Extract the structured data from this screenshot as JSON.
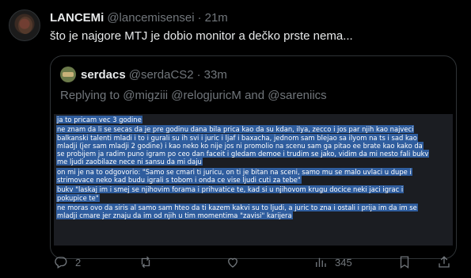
{
  "author": {
    "name": "LANCEMi",
    "handle": "@lancemisensei",
    "dot": "·",
    "time": "21m"
  },
  "tweet_text": "što je najgore MTJ je dobio monitor a dečko prste nema...",
  "quoted": {
    "name": "serdacs",
    "handle": "@serdaCS2",
    "dot": "·",
    "time": "33m",
    "replying_prefix": "Replying to",
    "mention1": "@migziii",
    "mention2": "@relogjuricM",
    "and_word": "and",
    "mention3": "@sareniics",
    "lines": [
      "ja to pricam vec 3 godine",
      "ne znam da li se secas da je pre godinu dana bila prica kao da su kdan, ilya, zecco i jos par njih kao najveci",
      "balkanski talenti mladi i to i gurali su ih svi i juric i ljaf i baxacha, jednom sam blejao sa ilyom na ts i sad kao",
      "mladji (jer sam mladji 2 godine) i kao neko ko nije jos ni promolio na scenu sam ga pitao ee brate kao kako da",
      "se probijem ja radim puno igram po ceo dan faceit i gledam demoe i trudim se jako, vidim da mi nesto fali bukv",
      "me ljudi zaobilaze nece ni sansu da mi daju",
      "on mi je na to odgovorio: \"Samo se cmari ti juricu, on ti je bitan na sceni, samo mu se malo uvlaci u dupe i",
      "strimovace neko kad budu igrali s tobom i onda ce vise ljudi cuti za tebe\"",
      "bukv \"laskaj im i smej se njihovim forama i prihvatice te, kad si u njihovom krugu docice neki jaci igrac i",
      "pokupice te\"",
      "ne moras ovo da siris al samo sam hteo da ti kazem kakvi su to ljudi, a juric to zna i ostali i prija im da im se",
      "mladji cmare jer znaju da im od njih u tim momentima \"zavisi\" karijera"
    ]
  },
  "actions": {
    "replies": "2",
    "reposts": "",
    "likes": "",
    "views": "345"
  }
}
